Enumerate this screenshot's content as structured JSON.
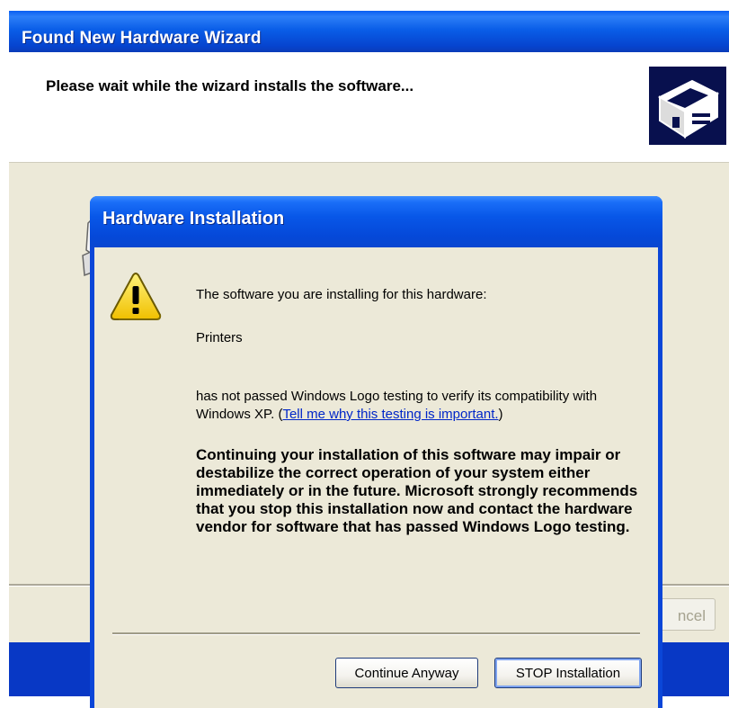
{
  "wizard": {
    "title": "Found New Hardware Wizard",
    "header_text": "Please wait while the wizard installs the software...",
    "cancel_label": "ncel"
  },
  "dialog": {
    "title": "Hardware Installation",
    "intro": "The software you are installing for this hardware:",
    "device": "Printers",
    "logo_text": "has not passed Windows Logo testing to verify its compatibility with Windows XP.",
    "link_open": "(",
    "link_text": "Tell me why this testing is important.",
    "link_close": ")",
    "warning": "Continuing your installation of this software may impair or destabilize the correct operation of your system either immediately or in the future. Microsoft strongly recommends that you stop this installation now and contact the hardware vendor for software that has passed Windows Logo testing.",
    "continue_label": "Continue Anyway",
    "stop_label": "STOP Installation"
  },
  "icons": {
    "warning": "warning-triangle-icon",
    "hardware": "hardware-box-icon"
  },
  "colors": {
    "titlebar_blue": "#0a5ee8",
    "dialog_face": "#ece9d8",
    "link": "#0026c8",
    "logo_bg": "#08104e"
  }
}
